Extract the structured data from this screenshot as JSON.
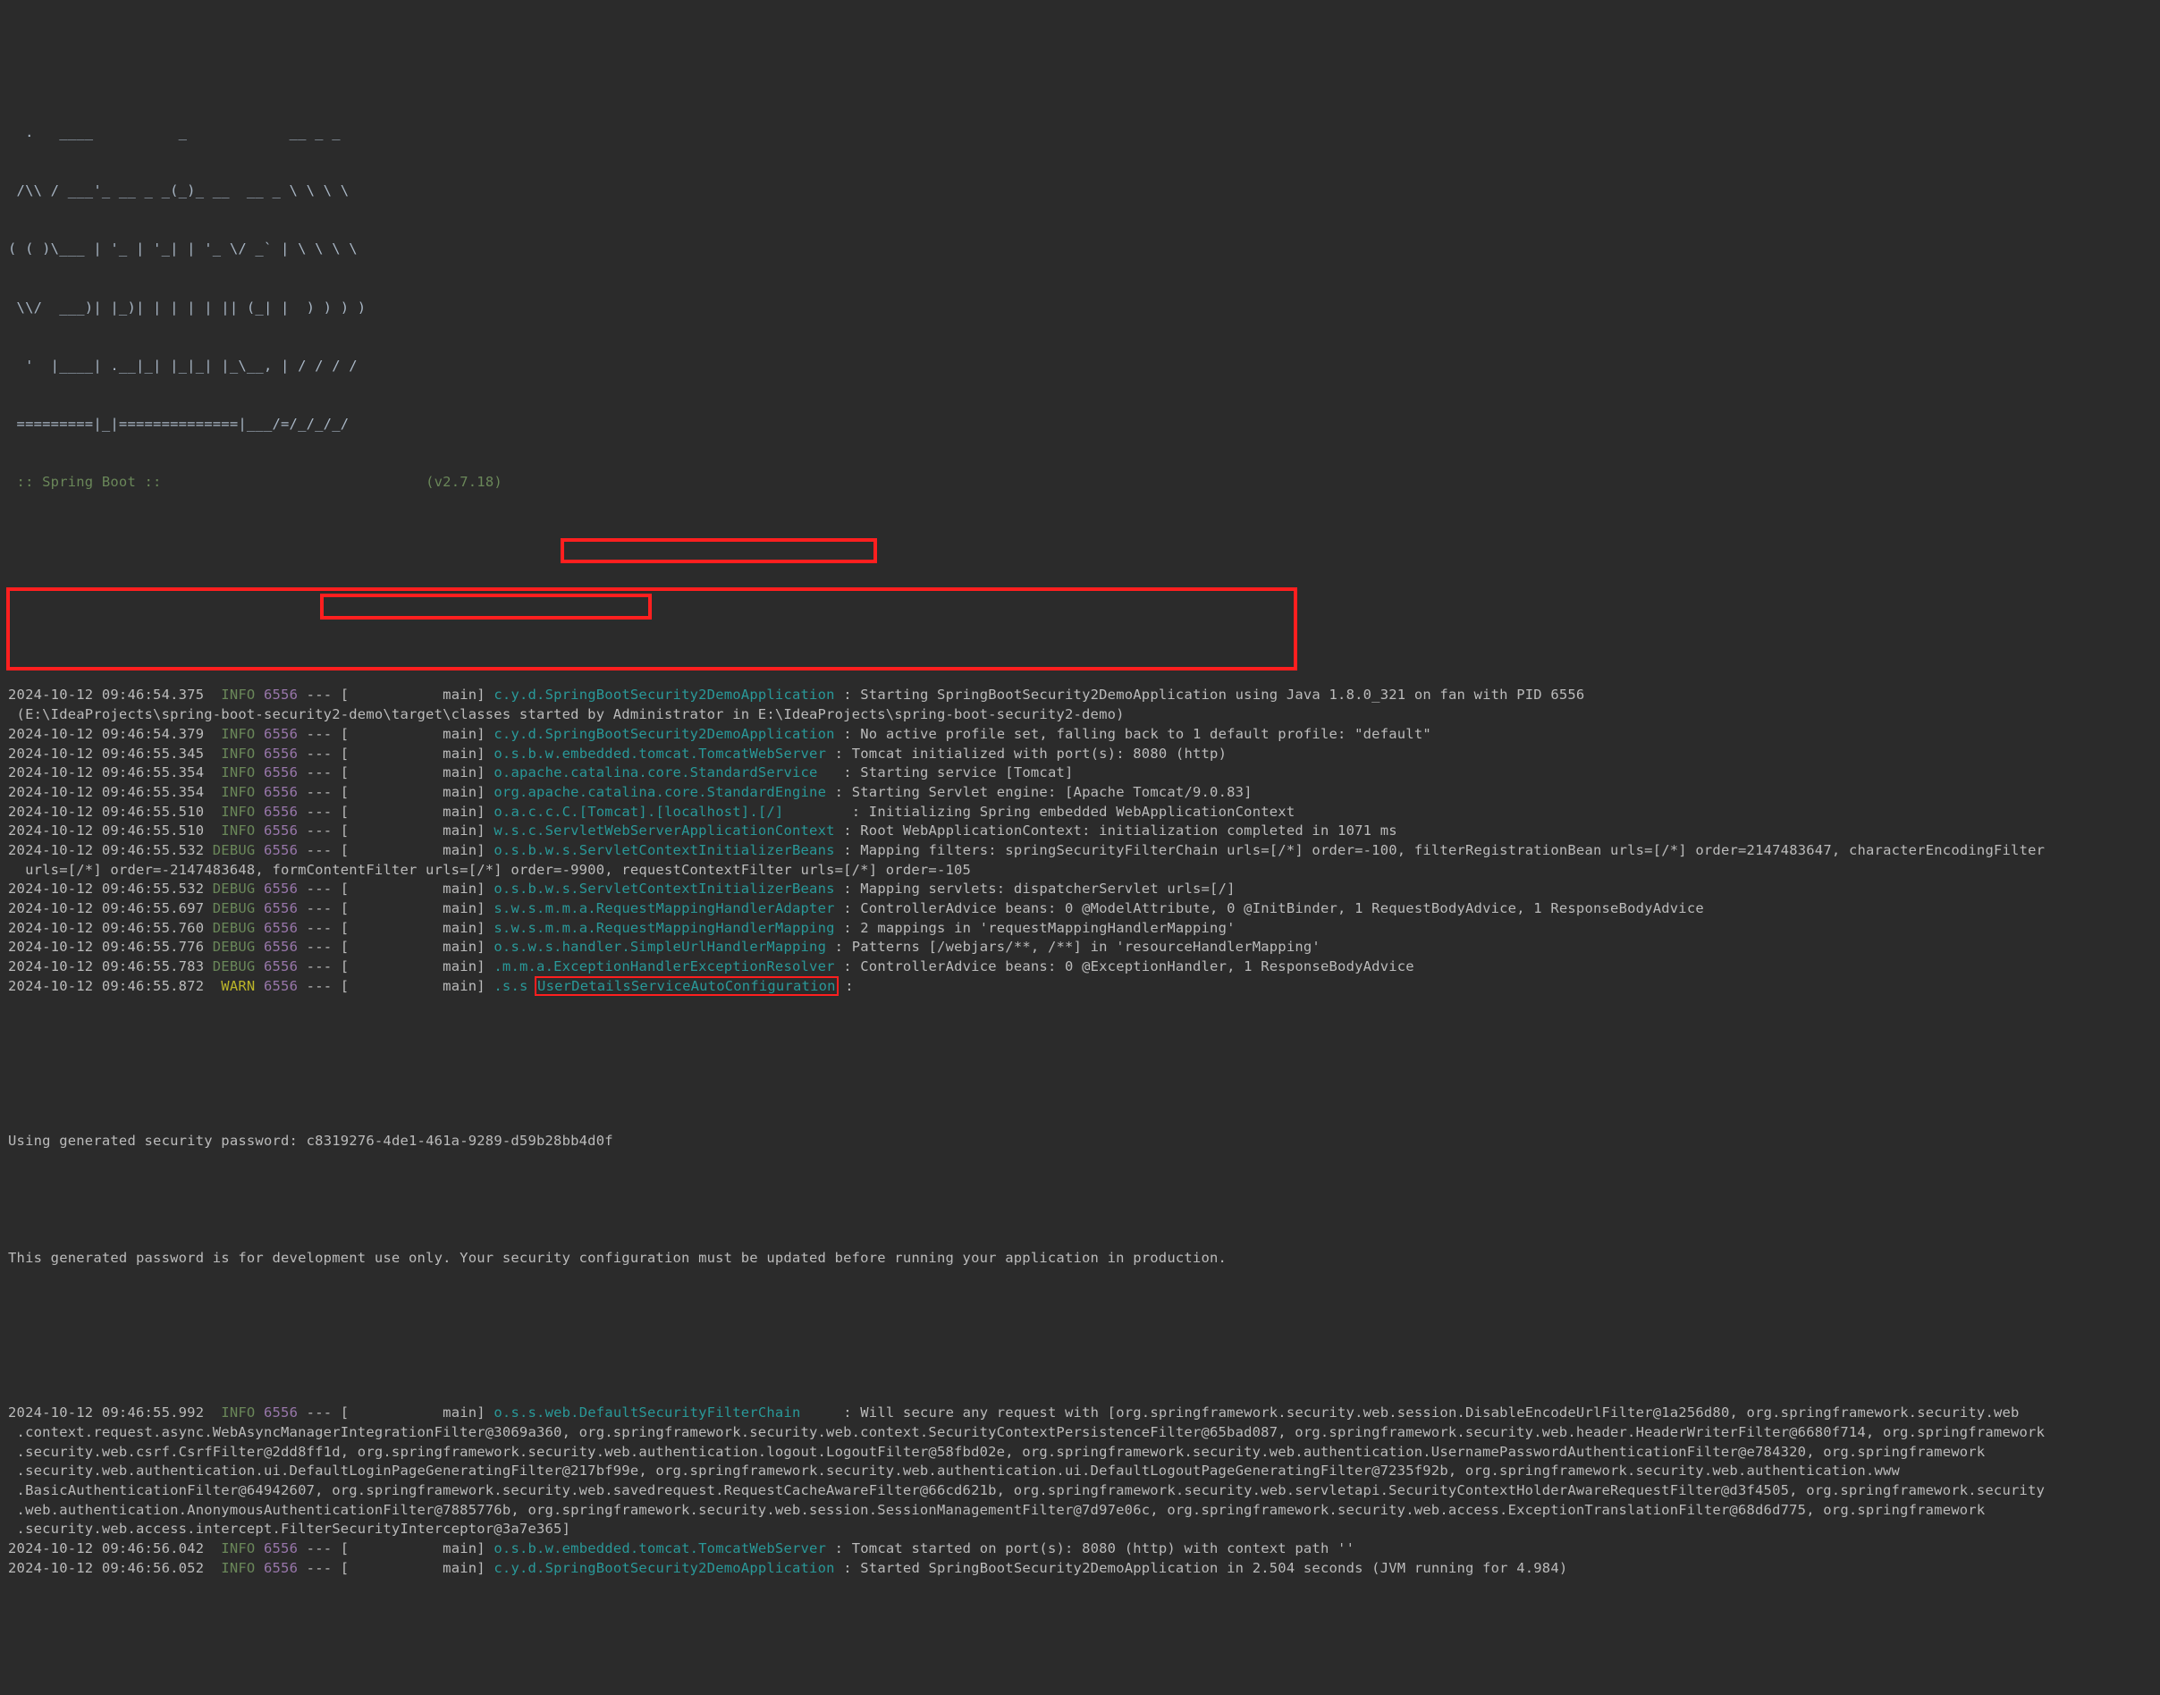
{
  "terminal": {
    "title": "Spring Boot application console log",
    "theme": {
      "background": "#2b2b2b",
      "foreground": "#bbbbbb",
      "info_color": "#6a8759",
      "debug_color": "#6a8759",
      "warn_color": "#bbb529",
      "pid_color": "#9876aa",
      "logger_color": "#299999",
      "banner_color": "#a9b7c6",
      "highlight_color": "#ff1f1f"
    }
  },
  "banner": {
    "art": [
      "  .   ____          _            __ _ _",
      " /\\\\ / ___'_ __ _ _(_)_ __  __ _ \\ \\ \\ \\",
      "( ( )\\___ | '_ | '_| | '_ \\/ _` | \\ \\ \\ \\",
      " \\\\/  ___)| |_)| | | | | || (_| |  ) ) ) )",
      "  '  |____| .__|_| |_|_| |_\\__, | / / / /",
      " =========|_|==============|___/=/_/_/_/"
    ],
    "footer_left": " :: Spring Boot :: ",
    "footer_version": "(v2.7.18)"
  },
  "log_lines": [
    {
      "type": "entry",
      "timestamp": "2024-10-12 09:46:54.375",
      "level": "INFO",
      "pid": "6556",
      "sep": "---",
      "thread": "[           main]",
      "logger": "c.y.d.SpringBootSecurity2DemoApplication",
      "message": ": Starting SpringBootSecurity2DemoApplication using Java 1.8.0_321 on fan with PID 6556"
    },
    {
      "type": "cont",
      "text": " (E:\\IdeaProjects\\spring-boot-security2-demo\\target\\classes started by Administrator in E:\\IdeaProjects\\spring-boot-security2-demo)"
    },
    {
      "type": "entry",
      "timestamp": "2024-10-12 09:46:54.379",
      "level": "INFO",
      "pid": "6556",
      "sep": "---",
      "thread": "[           main]",
      "logger": "c.y.d.SpringBootSecurity2DemoApplication",
      "message": ": No active profile set, falling back to 1 default profile: \"default\""
    },
    {
      "type": "entry",
      "timestamp": "2024-10-12 09:46:55.345",
      "level": "INFO",
      "pid": "6556",
      "sep": "---",
      "thread": "[           main]",
      "logger": "o.s.b.w.embedded.tomcat.TomcatWebServer",
      "message": ": Tomcat initialized with port(s): 8080 (http)"
    },
    {
      "type": "entry",
      "timestamp": "2024-10-12 09:46:55.354",
      "level": "INFO",
      "pid": "6556",
      "sep": "---",
      "thread": "[           main]",
      "logger": "o.apache.catalina.core.StandardService",
      "message": "  : Starting service [Tomcat]"
    },
    {
      "type": "entry",
      "timestamp": "2024-10-12 09:46:55.354",
      "level": "INFO",
      "pid": "6556",
      "sep": "---",
      "thread": "[           main]",
      "logger": "org.apache.catalina.core.StandardEngine",
      "message": ": Starting Servlet engine: [Apache Tomcat/9.0.83]"
    },
    {
      "type": "entry",
      "timestamp": "2024-10-12 09:46:55.510",
      "level": "INFO",
      "pid": "6556",
      "sep": "---",
      "thread": "[           main]",
      "logger": "o.a.c.c.C.[Tomcat].[localhost].[/]",
      "message": "       : Initializing Spring embedded WebApplicationContext"
    },
    {
      "type": "entry",
      "timestamp": "2024-10-12 09:46:55.510",
      "level": "INFO",
      "pid": "6556",
      "sep": "---",
      "thread": "[           main]",
      "logger": "w.s.c.ServletWebServerApplicationContext",
      "message": ": Root WebApplicationContext: initialization completed in 1071 ms"
    },
    {
      "type": "entry",
      "timestamp": "2024-10-12 09:46:55.532",
      "level": "DEBUG",
      "pid": "6556",
      "sep": "---",
      "thread": "[           main]",
      "logger": "o.s.b.w.s.ServletContextInitializerBeans",
      "message": ": Mapping filters: springSecurityFilterChain urls=[/*] order=-100, filterRegistrationBean urls=[/*] order=2147483647, characterEncodingFilter"
    },
    {
      "type": "cont",
      "text": "  urls=[/*] order=-2147483648, formContentFilter urls=[/*] order=-9900, requestContextFilter urls=[/*] order=-105"
    },
    {
      "type": "entry",
      "timestamp": "2024-10-12 09:46:55.532",
      "level": "DEBUG",
      "pid": "6556",
      "sep": "---",
      "thread": "[           main]",
      "logger": "o.s.b.w.s.ServletContextInitializerBeans",
      "message": ": Mapping servlets: dispatcherServlet urls=[/]"
    },
    {
      "type": "entry",
      "timestamp": "2024-10-12 09:46:55.697",
      "level": "DEBUG",
      "pid": "6556",
      "sep": "---",
      "thread": "[           main]",
      "logger": "s.w.s.m.m.a.RequestMappingHandlerAdapter",
      "message": ": ControllerAdvice beans: 0 @ModelAttribute, 0 @InitBinder, 1 RequestBodyAdvice, 1 ResponseBodyAdvice"
    },
    {
      "type": "entry",
      "timestamp": "2024-10-12 09:46:55.760",
      "level": "DEBUG",
      "pid": "6556",
      "sep": "---",
      "thread": "[           main]",
      "logger": "s.w.s.m.m.a.RequestMappingHandlerMapping",
      "message": ": 2 mappings in 'requestMappingHandlerMapping'"
    },
    {
      "type": "entry",
      "timestamp": "2024-10-12 09:46:55.776",
      "level": "DEBUG",
      "pid": "6556",
      "sep": "---",
      "thread": "[           main]",
      "logger": "o.s.w.s.handler.SimpleUrlHandlerMapping",
      "message": ": Patterns [/webjars/**, /**] in 'resourceHandlerMapping'"
    },
    {
      "type": "entry",
      "timestamp": "2024-10-12 09:46:55.783",
      "level": "DEBUG",
      "pid": "6556",
      "sep": "---",
      "thread": "[           main]",
      "logger": ".m.m.a.ExceptionHandlerExceptionResolver",
      "message": ": ControllerAdvice beans: 0 @ExceptionHandler, 1 ResponseBodyAdvice"
    },
    {
      "type": "warn_entry",
      "timestamp": "2024-10-12 09:46:55.872",
      "level": "WARN",
      "pid": "6556",
      "sep": "---",
      "thread": "[           main]",
      "logger_prefix": ".s.s ",
      "logger_highlighted": "UserDetailsServiceAutoConfiguration",
      "message": " :"
    }
  ],
  "password_block": {
    "label": "Using generated security password: ",
    "password": "c8319276-4de1-461a-9289-d59b28bb4d0f",
    "notice": "This generated password is for development use only. Your security configuration must be updated before running your application in production."
  },
  "log_lines_tail": [
    {
      "type": "entry",
      "timestamp": "2024-10-12 09:46:55.992",
      "level": "INFO",
      "pid": "6556",
      "sep": "---",
      "thread": "[           main]",
      "logger": "o.s.s.web.DefaultSecurityFilterChain",
      "message": "    : Will secure any request with [org.springframework.security.web.session.DisableEncodeUrlFilter@1a256d80, org.springframework.security.web"
    },
    {
      "type": "cont",
      "text": " .context.request.async.WebAsyncManagerIntegrationFilter@3069a360, org.springframework.security.web.context.SecurityContextPersistenceFilter@65bad087, org.springframework.security.web.header.HeaderWriterFilter@6680f714, org.springframework"
    },
    {
      "type": "cont",
      "text": " .security.web.csrf.CsrfFilter@2dd8ff1d, org.springframework.security.web.authentication.logout.LogoutFilter@58fbd02e, org.springframework.security.web.authentication.UsernamePasswordAuthenticationFilter@e784320, org.springframework"
    },
    {
      "type": "cont",
      "text": " .security.web.authentication.ui.DefaultLoginPageGeneratingFilter@217bf99e, org.springframework.security.web.authentication.ui.DefaultLogoutPageGeneratingFilter@7235f92b, org.springframework.security.web.authentication.www"
    },
    {
      "type": "cont",
      "text": " .BasicAuthenticationFilter@64942607, org.springframework.security.web.savedrequest.RequestCacheAwareFilter@66cd621b, org.springframework.security.web.servletapi.SecurityContextHolderAwareRequestFilter@d3f4505, org.springframework.security"
    },
    {
      "type": "cont",
      "text": " .web.authentication.AnonymousAuthenticationFilter@7885776b, org.springframework.security.web.session.SessionManagementFilter@7d97e06c, org.springframework.security.web.access.ExceptionTranslationFilter@68d6d775, org.springframework"
    },
    {
      "type": "cont",
      "text": " .security.web.access.intercept.FilterSecurityInterceptor@3a7e365]"
    },
    {
      "type": "entry",
      "timestamp": "2024-10-12 09:46:56.042",
      "level": "INFO",
      "pid": "6556",
      "sep": "---",
      "thread": "[           main]",
      "logger": "o.s.b.w.embedded.tomcat.TomcatWebServer",
      "message": ": Tomcat started on port(s): 8080 (http) with context path ''"
    },
    {
      "type": "entry",
      "timestamp": "2024-10-12 09:46:56.052",
      "level": "INFO",
      "pid": "6556",
      "sep": "---",
      "thread": "[           main]",
      "logger": "c.y.d.SpringBootSecurity2DemoApplication",
      "message": ": Started SpringBootSecurity2DemoApplication in 2.504 seconds (JVM running for 4.984)"
    }
  ]
}
